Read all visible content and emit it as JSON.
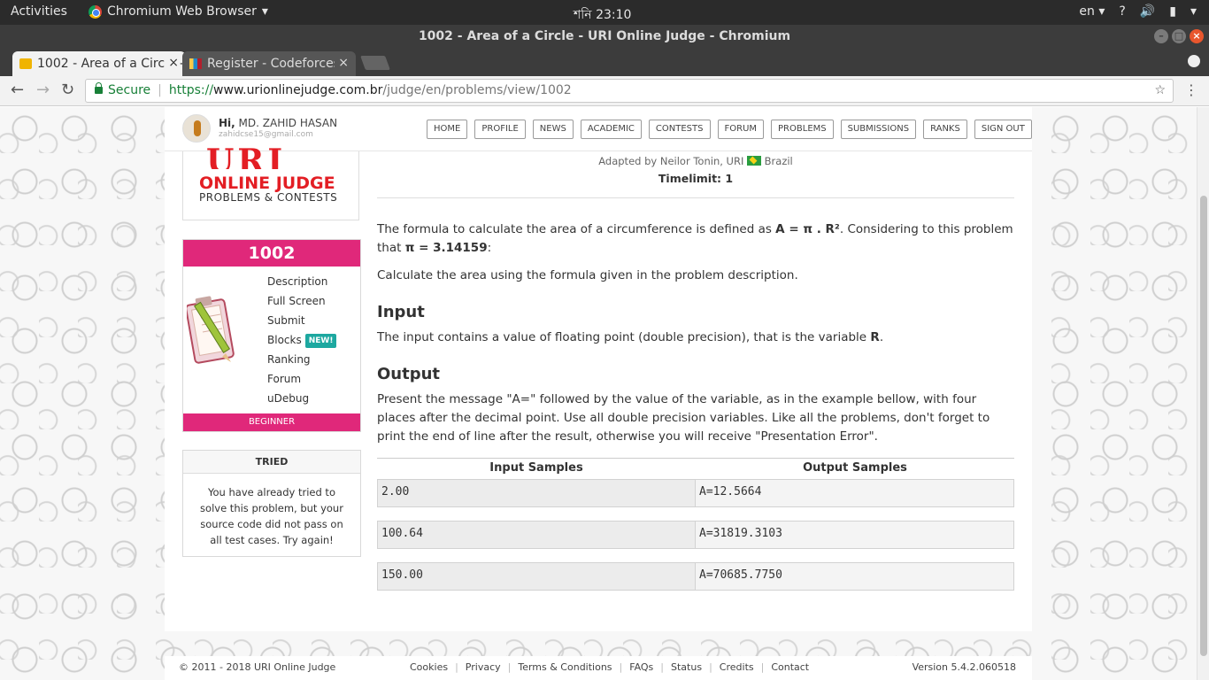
{
  "os": {
    "activities": "Activities",
    "app_menu": "Chromium Web Browser",
    "clock": "শনি 23:10",
    "lang": "en"
  },
  "window": {
    "title": "1002 - Area of a Circle - URI Online Judge - Chromium"
  },
  "tabs": [
    {
      "label": "1002 - Area of a Circle - URI Online Judge"
    },
    {
      "label": "Register - Codeforces"
    }
  ],
  "address": {
    "secure_label": "Secure",
    "url_scheme": "https://",
    "url_host": "www.urionlinejudge.com.br",
    "url_path": "/judge/en/problems/view/1002"
  },
  "header": {
    "hi": "Hi,",
    "user_name": "MD. ZAHID HASAN",
    "user_email": "zahidcse15@gmail.com",
    "nav": [
      "HOME",
      "PROFILE",
      "NEWS",
      "ACADEMIC",
      "CONTESTS",
      "FORUM",
      "PROBLEMS",
      "SUBMISSIONS",
      "RANKS",
      "SIGN OUT"
    ]
  },
  "logo": {
    "big": "URI",
    "line1": "ONLINE JUDGE",
    "line2": "PROBLEMS & CONTESTS"
  },
  "problem_box": {
    "number": "1002",
    "menu": [
      "Description",
      "Full Screen",
      "Submit",
      "Blocks",
      "Ranking",
      "Forum",
      "uDebug"
    ],
    "new_badge": "NEW!",
    "level": "BEGINNER"
  },
  "tried": {
    "title": "TRIED",
    "text": "You have already tried to solve this problem, but your source code did not pass on all test cases. Try again!"
  },
  "problem": {
    "adapted": "Adapted by Neilor Tonin, URI",
    "country": "Brazil",
    "timelimit": "Timelimit: 1",
    "intro_a": "The formula to calculate the area of a circumference is defined as ",
    "formula": "A = π . R²",
    "intro_b": ". Considering to this problem that ",
    "pi_eq": "π = 3.14159",
    "intro_c": ":",
    "task": "Calculate the area using the formula given in the problem description.",
    "input_title": "Input",
    "input_a": "The input contains a value of floating point (double precision), that is the variable ",
    "input_var": "R",
    "input_b": ".",
    "output_title": "Output",
    "output_text": "Present the message \"A=\" followed by the value of the variable, as in the example bellow, with four places after the decimal point. Use all double precision variables. Like all the problems, don't forget to print the end of line after the result, otherwise you will receive \"Presentation Error\"."
  },
  "samples": {
    "input_header": "Input Samples",
    "output_header": "Output Samples",
    "rows": [
      {
        "input": "2.00",
        "output": "A=12.5664"
      },
      {
        "input": "100.64",
        "output": "A=31819.3103"
      },
      {
        "input": "150.00",
        "output": "A=70685.7750"
      }
    ]
  },
  "footer": {
    "copyright": "© 2011 - 2018 URI Online Judge",
    "links": [
      "Cookies",
      "Privacy",
      "Terms & Conditions",
      "FAQs",
      "Status",
      "Credits",
      "Contact"
    ],
    "version": "Version 5.4.2.060518"
  }
}
